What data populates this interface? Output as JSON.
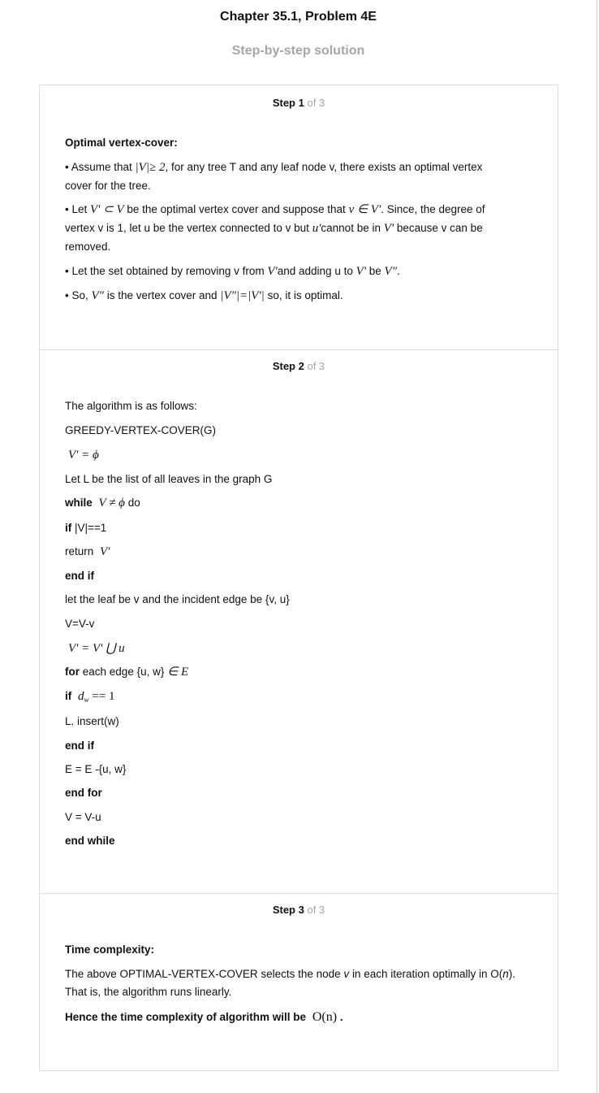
{
  "header": {
    "title": "Chapter 35.1, Problem 4E",
    "subtitle": "Step-by-step solution"
  },
  "steps": [
    {
      "label": "Step 1",
      "of": "of 3",
      "heading": "Optimal vertex-cover:",
      "p1_a": "• Assume that",
      "p1_math": "|V|≥ 2",
      "p1_b": ", for any tree T and any leaf node v, there exists an optimal vertex",
      "p1_c": "cover for the tree.",
      "p2_a": "• Let",
      "p2_math1": "V' ⊂ V",
      "p2_b": "be the optimal vertex cover and suppose that",
      "p2_math2": "v ∈ V'",
      "p2_c": ". Since, the degree of",
      "p2_d": "vertex v is 1, let u be the vertex connected to v but",
      "p2_math3": "u'",
      "p2_e": "cannot be in",
      "p2_math4": "V'",
      "p2_f": "because v can be",
      "p2_g": "removed.",
      "p3_a": "• Let the set obtained by removing v from",
      "p3_math1": "V'",
      "p3_b": "and adding u to",
      "p3_math2": "V'",
      "p3_c": "be",
      "p3_math3": "V\"",
      "p3_d": ".",
      "p4_a": "• So,",
      "p4_math1": "V\"",
      "p4_b": "is the vertex cover and",
      "p4_math2": "|V\"|=|V'|",
      "p4_c": "so, it is optimal."
    },
    {
      "label": "Step 2",
      "of": "of 3",
      "intro": "The algorithm is as follows:",
      "func": "GREEDY-VERTEX-COVER(G)",
      "init_math": "V' = ϕ",
      "leaves": "Let L be the list of all leaves in the graph G",
      "while_kw": "while",
      "while_math": "V ≠ ϕ",
      "while_do": "do",
      "if1_kw": "if",
      "if1_cond": "|V|==1",
      "return_kw": "return",
      "return_math": "V'",
      "endif1": "end if",
      "let_leaf": "let the leaf be v and the incident edge be {v, u}",
      "vminus": "V=V-v",
      "union_math": "V' = V' ⋃ u",
      "for_kw": "for",
      "for_text": "each edge {u, w}",
      "for_math": "∈ E",
      "if2_kw": "if",
      "if2_math": "d",
      "if2_sub": "w",
      "if2_rest": "== 1",
      "insert": "L. insert(w)",
      "endif2": "end if",
      "edge_update": "E = E -{u, w}",
      "endfor": "end for",
      "vminusu": "V = V-u",
      "endwhile": "end while"
    },
    {
      "label": "Step 3",
      "of": "of 3",
      "heading": "Time complexity:",
      "p1_a": "The above OPTIMAL-VERTEX-COVER selects the node",
      "p1_v": "v",
      "p1_b": "in each iteration optimally in O(",
      "p1_n": "n",
      "p1_c": ").",
      "p2": "That is, the algorithm runs linearly.",
      "conclusion": "Hence the time complexity of algorithm will be",
      "conclusion_math": "O(n)",
      "conclusion_end": "."
    }
  ]
}
